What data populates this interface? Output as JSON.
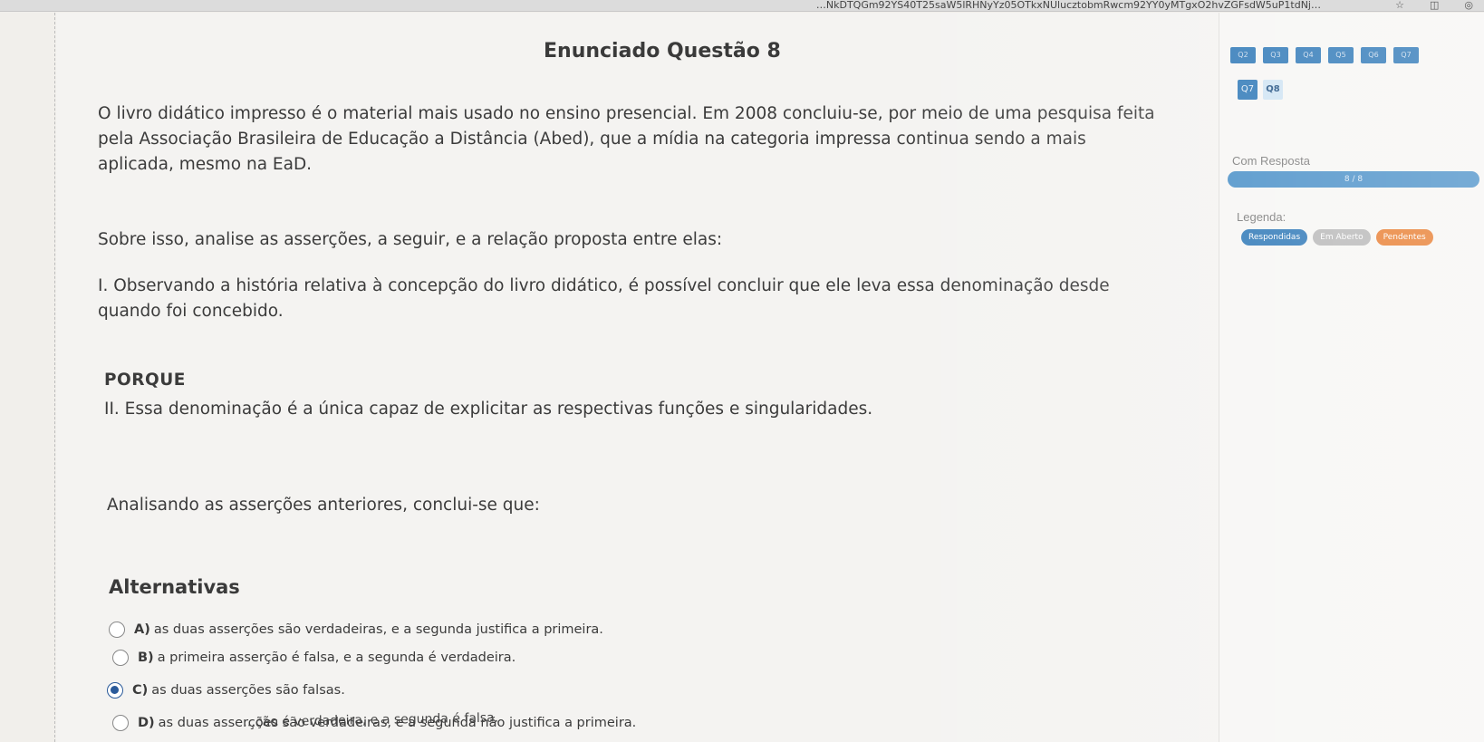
{
  "browser": {
    "url": "…NkDTQGm92YS40T25saW5lRHNyYz05OTkxNUlucztobmRwcm92YY0yMTgxO2hvZGFsdW5uP1tdNj…",
    "star_icon": "star-icon",
    "extension_icon": "puzzle-icon",
    "profile_icon": "profile-icon"
  },
  "question": {
    "title": "Enunciado Questão 8",
    "intro": "O livro didático impresso é o material mais usado no ensino presencial. Em 2008 concluiu-se, por meio de uma pesquisa feita pela Associação Brasileira de Educação a Distância (Abed), que a mídia na categoria impressa continua sendo a mais aplicada, mesmo na EaD.",
    "ask": "Sobre isso, analise as asserções, a seguir, e a relação proposta entre elas:",
    "assertion_one": "I. Observando a história relativa à concepção do livro didático, é possível concluir que ele leva essa denominação desde quando foi concebido.",
    "porque": "PORQUE",
    "assertion_two": "II. Essa denominação é a única capaz de explicitar as respectivas funções e singularidades.",
    "analysis": "Analisando as asserções anteriores, conclui-se que:"
  },
  "alternatives": {
    "title": "Alternativas",
    "options": [
      {
        "letter": "A)",
        "text": "as duas asserções são verdadeiras, e a segunda justifica a primeira.",
        "selected": false
      },
      {
        "letter": "B)",
        "text": "a primeira asserção é falsa, e a segunda é verdadeira.",
        "selected": false
      },
      {
        "letter": "C)",
        "text": "as duas asserções são falsas.",
        "selected": true
      },
      {
        "letter": "D)",
        "text": "as duas asserções são verdadeiras, e a segunda não justifica a primeira.",
        "selected": false
      }
    ],
    "partial_e": "…ção é verdadeira, e a segunda é falsa."
  },
  "sidebar": {
    "question_buttons": [
      "Q2",
      "Q3",
      "Q4",
      "Q5",
      "Q6",
      "Q7"
    ],
    "current_row": [
      "Q7",
      "Q8"
    ],
    "current": "Q8",
    "answered_label": "Com Resposta",
    "progress_text": "8 / 8",
    "progress": 1.0,
    "legend_label": "Legenda:",
    "legend": {
      "answered": "Respondidas",
      "open": "Em Aberto",
      "pending": "Pendentes"
    }
  },
  "colors": {
    "accent": "#2e78b7",
    "pending": "#e87c2e",
    "open": "#b8b8b8"
  }
}
